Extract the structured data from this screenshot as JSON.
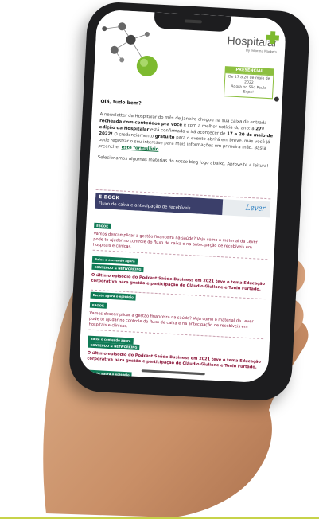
{
  "colors": {
    "brand_green": "#8cbf3f",
    "cta_green": "#0f7a55",
    "accent_red": "#8a1538",
    "phone": "#1d1d1f"
  },
  "header": {
    "logo": "Hospitalar",
    "logo_sub": "By Informa Markets",
    "badge_tag": "PRESENCIAL",
    "badge_line1": "De 17 a 20 de maio de 2022",
    "badge_line2": "Agora no São Paulo Expo!"
  },
  "email": {
    "greeting": "Olá, tudo bem?",
    "p1_a": "A newsletter da Hospitalar do mês de Janeiro chegou na sua caixa de entrada ",
    "p1_b": "recheada com conteúdos pra você",
    "p1_c": " e com a melhor notícia do ano: a ",
    "p1_d": "27ª edição da Hospitalar",
    "p1_e": " está confirmada e irá acontecer de ",
    "p1_f": "17 a 20 de maio de 2022!",
    "p1_g": " O credenciamento ",
    "p1_h": "gratuito",
    "p1_i": " para o evento abrirá em breve, mas você já pode registrar o seu interesse para mais informações em primeira mão. Basta preencher ",
    "p1_link": "este formulário",
    "p1_end": ".",
    "p2": "Selecionamos algumas matérias do nosso blog logo abaixo. Aproveite a leitura!"
  },
  "ebook": {
    "title": "E-BOOK",
    "subtitle": "Fluxo de caixa e antecipação de recebíveis",
    "brand": "Lever"
  },
  "articles": [
    {
      "tag": "EBOOK",
      "text": "Vamos descomplicar a gestão financeira na saúde? Veja como o material da Lever pode te ajudar no controle do fluxo de caixa e na antecipação de recebíveis em hospitais e clínicas.",
      "cta": "Baixe o conteúdo agora"
    },
    {
      "tag": "CONTEÚDO & NETWORKING",
      "text": "O último episódio do Podcast Saúde Business em 2021 teve o tema Educação corporativa para gestão e participação de Cláudio Giulione e Tonio Furtado.",
      "cta": "Escute agora o episódio"
    },
    {
      "tag": "EBOOK",
      "text": "Vamos descomplicar a gestão financeira na saúde? Veja como o material da Lever pode te ajudar no controle do fluxo de caixa e na antecipação de recebíveis em hospitais e clínicas.",
      "cta": "Baixe o conteúdo agora"
    },
    {
      "tag": "CONTEÚDO & NETWORKING",
      "text": "O último episódio do Podcast Saúde Business em 2021 teve o tema Educação corporativa para gestão e participação de Cláudio Giulione e Tonio Furtado.",
      "cta": "Escute agora o episódio"
    }
  ]
}
